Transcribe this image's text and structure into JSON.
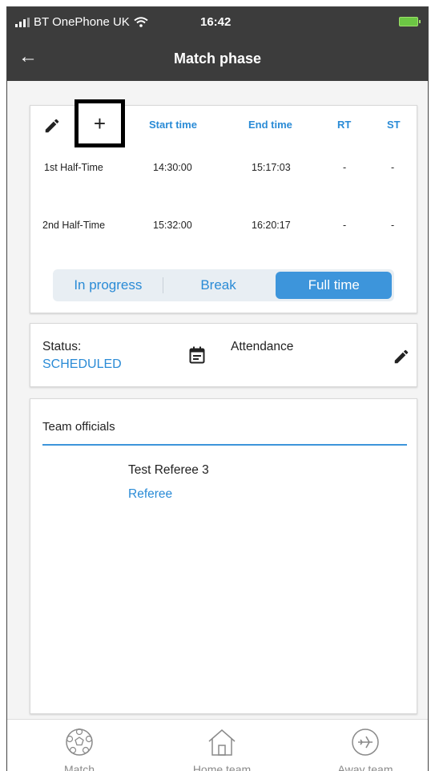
{
  "status_bar": {
    "carrier": "BT OnePhone UK",
    "time": "16:42"
  },
  "app_bar": {
    "title": "Match phase"
  },
  "phases": {
    "columns": [
      "Start time",
      "End time",
      "RT",
      "ST"
    ],
    "rows": [
      {
        "name": "1st Half-Time",
        "start": "14:30:00",
        "end": "15:17:03",
        "rt": "-",
        "st": "-"
      },
      {
        "name": "2nd Half-Time",
        "start": "15:32:00",
        "end": "16:20:17",
        "rt": "-",
        "st": "-"
      }
    ],
    "add_symbol": "+"
  },
  "segment": {
    "options": [
      "In progress",
      "Break",
      "Full time"
    ],
    "selected": "Full time"
  },
  "status_card": {
    "label": "Status:",
    "value": "SCHEDULED",
    "attendance_label": "Attendance"
  },
  "officials": {
    "tab_label": "Team officials",
    "name": "Test Referee 3",
    "role": "Referee"
  },
  "bottom_nav": {
    "items": [
      "Match",
      "Home team",
      "Away team"
    ]
  },
  "colors": {
    "accent": "#3d95db",
    "appbar": "#3c3c3c"
  }
}
